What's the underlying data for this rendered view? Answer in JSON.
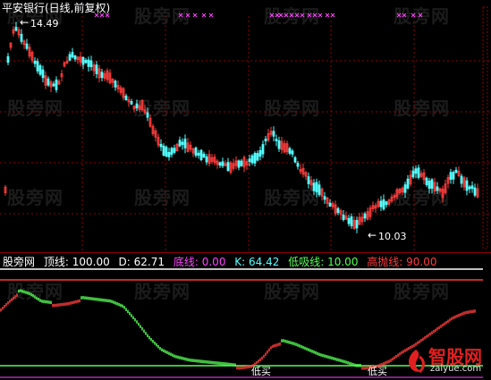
{
  "upper_panel": {
    "title": "平安银行(日线,前复权)",
    "high_label": "14.49",
    "low_label": "10.03",
    "title_color": "#ffffff",
    "up_color": "#ff3c3c",
    "down_color": "#54ffff",
    "marker_color": "#ff44ff",
    "grid_color": "#8b0000"
  },
  "indicator_legend": {
    "name": "股旁网",
    "items": [
      {
        "label": "顶线:",
        "value": "100.00",
        "color": "#ffffff"
      },
      {
        "label": "D:",
        "value": "62.71",
        "color": "#ffffff"
      },
      {
        "label": "底线:",
        "value": "0.00",
        "color": "#ff44ff"
      },
      {
        "label": "K:",
        "value": "64.42",
        "color": "#54ffff"
      },
      {
        "label": "低吸线:",
        "value": "10.00",
        "color": "#54ff54"
      },
      {
        "label": "高抛线:",
        "value": "90.00",
        "color": "#ff3c3c"
      }
    ]
  },
  "lower_panel": {
    "buy_signal_1": "低买",
    "buy_signal_2": "低买",
    "line_top_color": "#ffffff",
    "line_high_color": "#ff3c3c",
    "line_low_color": "#54ff54",
    "rise_color": "#ff3c3c",
    "fall_color": "#54ff54"
  },
  "watermark": "股旁网",
  "logo": {
    "brand": "智股网",
    "url": "zaiyue.com"
  }
}
